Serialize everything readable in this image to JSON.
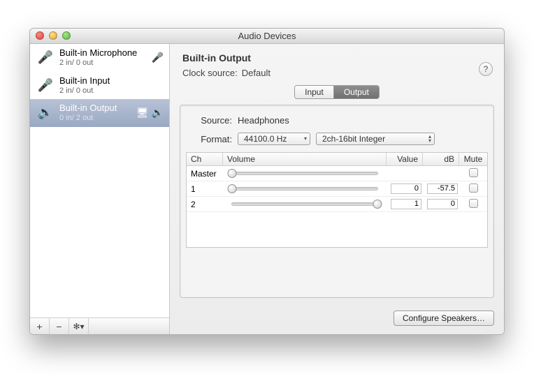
{
  "window": {
    "title": "Audio Devices"
  },
  "sidebar": {
    "devices": [
      {
        "name": "Built-in Microphone",
        "sub": "2 in/ 0 out",
        "icon": "microphone-icon",
        "badge": "microphone-icon",
        "selected": false
      },
      {
        "name": "Built-in Input",
        "sub": "2 in/ 0 out",
        "icon": "microphone-icon",
        "badge": "",
        "selected": false
      },
      {
        "name": "Built-in Output",
        "sub": "0 in/ 2 out",
        "icon": "speaker-icon",
        "badge": "system-sound-icons",
        "selected": true
      }
    ],
    "toolbar": {
      "add": "+",
      "remove": "−",
      "gear": "✻▾"
    }
  },
  "main": {
    "title": "Built-in Output",
    "clock_label": "Clock source:",
    "clock_value": "Default",
    "tabs": {
      "input": "Input",
      "output": "Output",
      "active": "output"
    },
    "source_label": "Source:",
    "source_value": "Headphones",
    "format_label": "Format:",
    "format_rate": "44100.0 Hz",
    "format_bit": "2ch-16bit Integer",
    "table": {
      "headers": {
        "ch": "Ch",
        "vol": "Volume",
        "val": "Value",
        "db": "dB",
        "mute": "Mute"
      },
      "rows": [
        {
          "ch": "Master",
          "slider": 0,
          "value": "",
          "db": "",
          "mute": false
        },
        {
          "ch": "1",
          "slider": 0,
          "value": "0",
          "db": "-57.5",
          "mute": false
        },
        {
          "ch": "2",
          "slider": 100,
          "value": "1",
          "db": "0",
          "mute": false
        }
      ]
    },
    "configure_label": "Configure Speakers…"
  }
}
